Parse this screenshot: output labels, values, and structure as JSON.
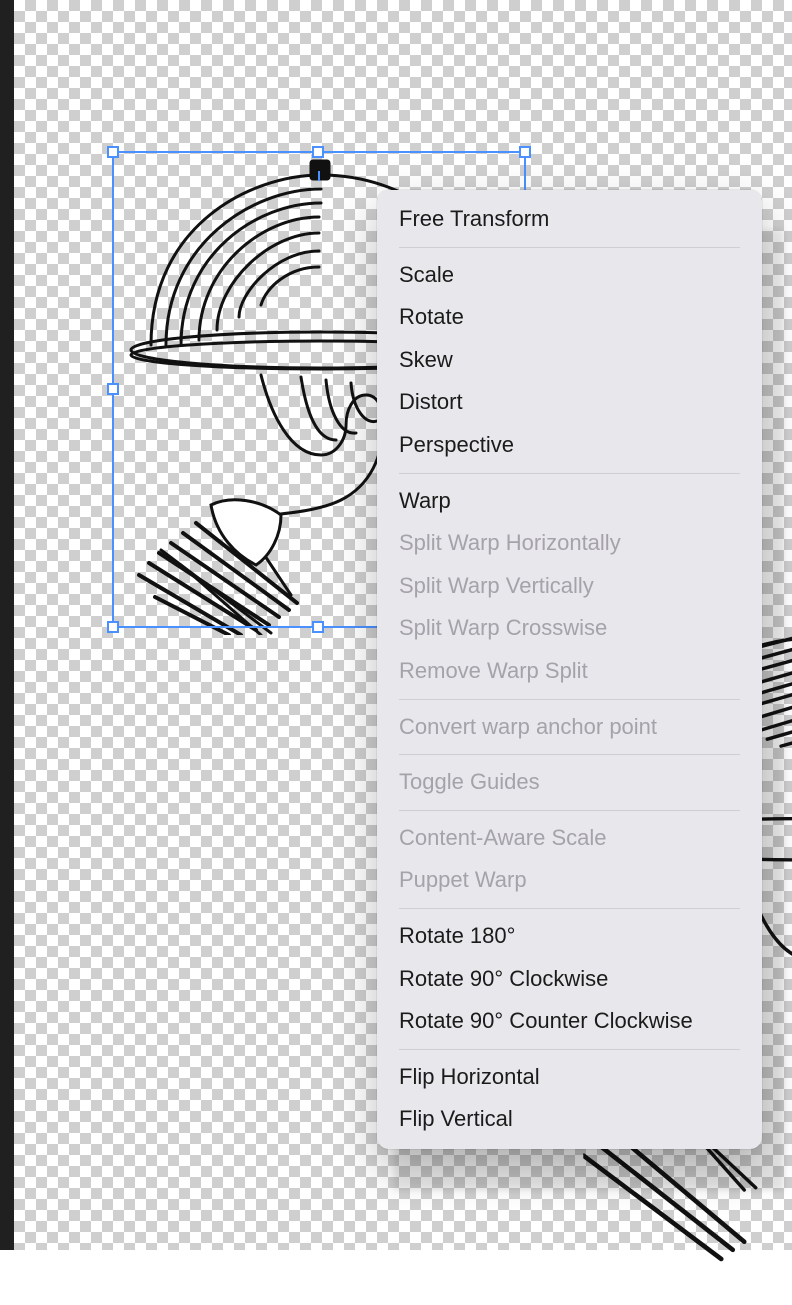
{
  "menu": {
    "groups": [
      [
        {
          "label": "Free Transform",
          "enabled": true,
          "name": "menu-free-transform"
        }
      ],
      [
        {
          "label": "Scale",
          "enabled": true,
          "name": "menu-scale"
        },
        {
          "label": "Rotate",
          "enabled": true,
          "name": "menu-rotate"
        },
        {
          "label": "Skew",
          "enabled": true,
          "name": "menu-skew"
        },
        {
          "label": "Distort",
          "enabled": true,
          "name": "menu-distort"
        },
        {
          "label": "Perspective",
          "enabled": true,
          "name": "menu-perspective"
        }
      ],
      [
        {
          "label": "Warp",
          "enabled": true,
          "name": "menu-warp"
        },
        {
          "label": "Split Warp Horizontally",
          "enabled": false,
          "name": "menu-split-warp-horizontally"
        },
        {
          "label": "Split Warp Vertically",
          "enabled": false,
          "name": "menu-split-warp-vertically"
        },
        {
          "label": "Split Warp Crosswise",
          "enabled": false,
          "name": "menu-split-warp-crosswise"
        },
        {
          "label": "Remove Warp Split",
          "enabled": false,
          "name": "menu-remove-warp-split"
        }
      ],
      [
        {
          "label": "Convert warp anchor point",
          "enabled": false,
          "name": "menu-convert-warp-anchor-point"
        }
      ],
      [
        {
          "label": "Toggle Guides",
          "enabled": false,
          "name": "menu-toggle-guides"
        }
      ],
      [
        {
          "label": "Content-Aware Scale",
          "enabled": false,
          "name": "menu-content-aware-scale"
        },
        {
          "label": "Puppet Warp",
          "enabled": false,
          "name": "menu-puppet-warp"
        }
      ],
      [
        {
          "label": "Rotate 180°",
          "enabled": true,
          "name": "menu-rotate-180"
        },
        {
          "label": "Rotate 90° Clockwise",
          "enabled": true,
          "name": "menu-rotate-90-cw"
        },
        {
          "label": "Rotate 90° Counter Clockwise",
          "enabled": true,
          "name": "menu-rotate-90-ccw"
        }
      ],
      [
        {
          "label": "Flip Horizontal",
          "enabled": true,
          "name": "menu-flip-horizontal"
        },
        {
          "label": "Flip Vertical",
          "enabled": true,
          "name": "menu-flip-vertical"
        }
      ]
    ]
  },
  "selection": {
    "accent_color": "#4a90ff"
  }
}
